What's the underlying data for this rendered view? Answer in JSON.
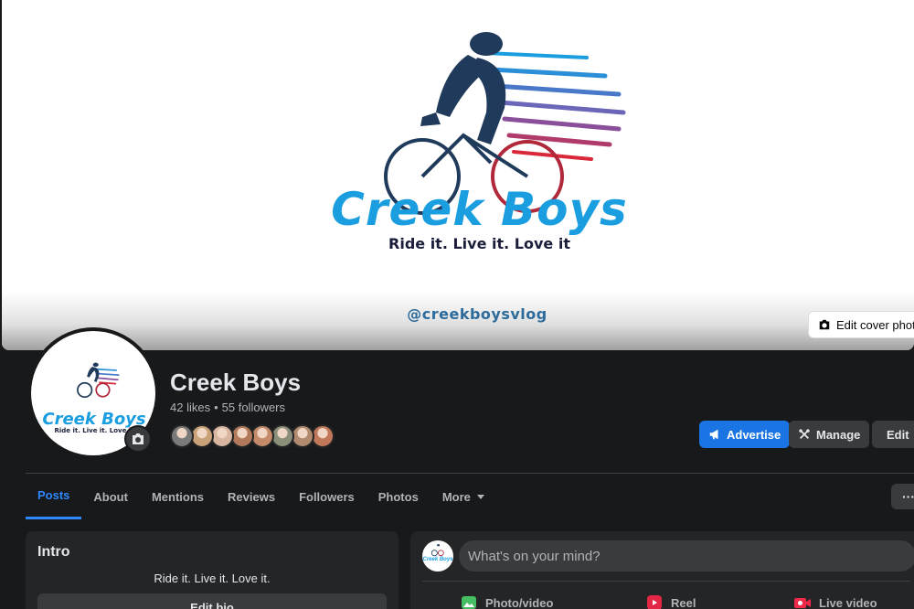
{
  "cover": {
    "brand_name": "Creek Boys",
    "tagline": "Ride it. Live it. Love it",
    "handle": "@creekboysvlog",
    "edit_label": "Edit cover photo"
  },
  "page": {
    "name": "Creek Boys",
    "likes": "42 likes",
    "separator": "•",
    "followers": "55 followers",
    "follower_avatar_colors": [
      "#7a7a7a",
      "#c9a27a",
      "#d8b5a0",
      "#b27a5a",
      "#c48a6a",
      "#8a8f7a",
      "#b08a6e",
      "#c1785a"
    ]
  },
  "actions": {
    "advertise": "Advertise",
    "manage": "Manage",
    "edit": "Edit"
  },
  "tabs": [
    {
      "label": "Posts"
    },
    {
      "label": "About"
    },
    {
      "label": "Mentions"
    },
    {
      "label": "Reviews"
    },
    {
      "label": "Followers"
    },
    {
      "label": "Photos"
    },
    {
      "label": "More"
    }
  ],
  "more_menu": "···",
  "intro": {
    "title": "Intro",
    "bio": "Ride it. Live it. Love it.",
    "edit_bio": "Edit bio"
  },
  "composer": {
    "placeholder": "What's on your mind?",
    "avatar_text": "Creek Boys",
    "options": [
      {
        "label": "Photo/video",
        "color": "#45bd62"
      },
      {
        "label": "Reel",
        "color": "#e42645"
      },
      {
        "label": "Live video",
        "color": "#f02849"
      }
    ]
  },
  "colors": {
    "accent": "#1b74e4",
    "tab_active": "#2d88ff",
    "brand_blue": "#1a9ee0"
  }
}
